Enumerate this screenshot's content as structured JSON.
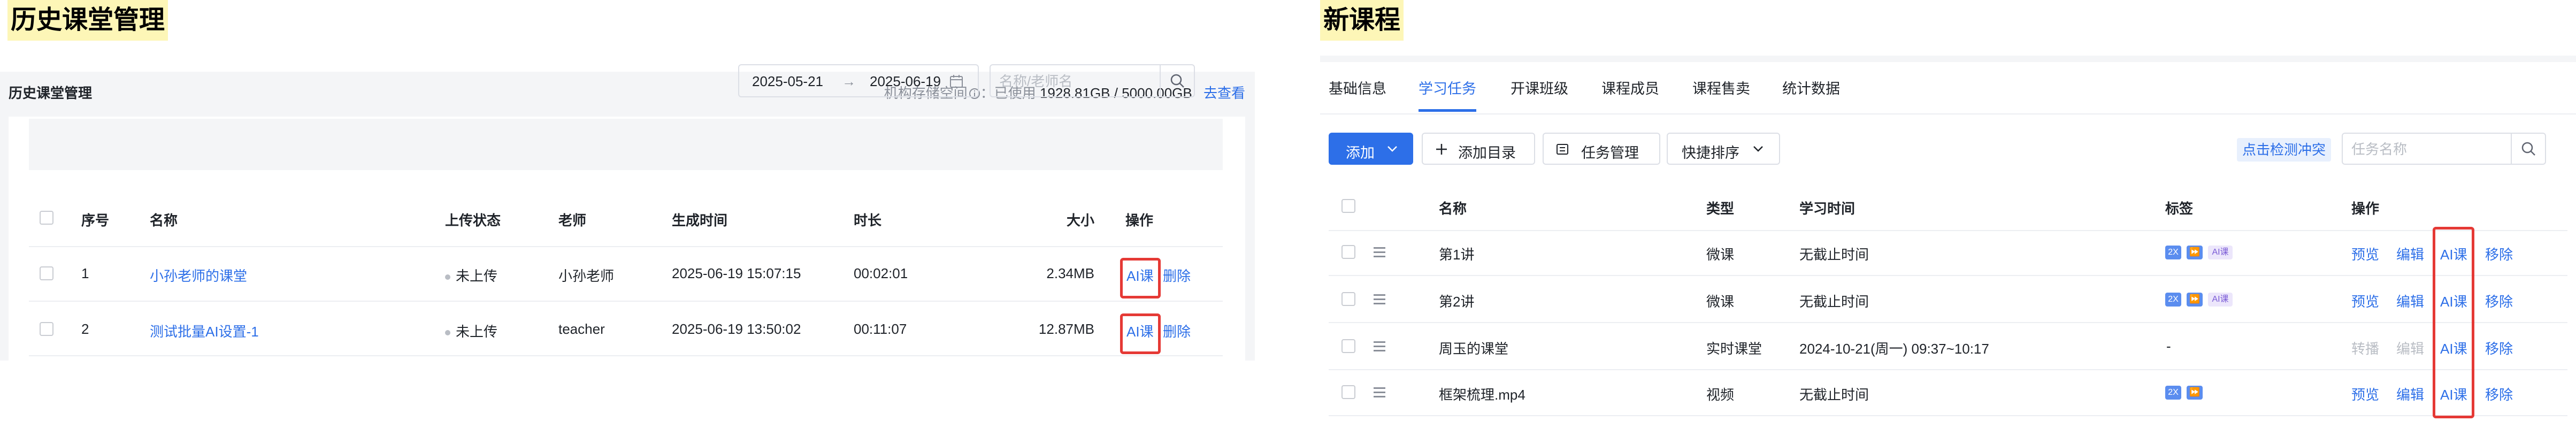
{
  "left": {
    "section_title": "历史课堂管理",
    "panel_title": "历史课堂管理",
    "storage": {
      "label": "机构存储空间",
      "info_icon": "info-circle-icon",
      "used_label": "：已使用",
      "value": "1928.81GB / 5000.00GB",
      "link": "去查看"
    },
    "date_range": {
      "start": "2025-05-21",
      "separator": "→",
      "end": "2025-06-19",
      "icon": "calendar-icon"
    },
    "search": {
      "placeholder": "名称/老师名",
      "icon": "search-icon"
    },
    "columns": {
      "index": "序号",
      "name": "名称",
      "upload_status": "上传状态",
      "teacher": "老师",
      "created": "生成时间",
      "duration": "时长",
      "size": "大小",
      "actions": "操作"
    },
    "rows": [
      {
        "index": "1",
        "name": "小孙老师的课堂",
        "upload_status": "未上传",
        "teacher": "小孙老师",
        "created": "2025-06-19 15:07:15",
        "duration": "00:02:01",
        "size": "2.34MB",
        "action_ai": "AI课",
        "action_delete": "删除"
      },
      {
        "index": "2",
        "name": "测试批量AI设置-1",
        "upload_status": "未上传",
        "teacher": "teacher",
        "created": "2025-06-19 13:50:02",
        "duration": "00:11:07",
        "size": "12.87MB",
        "action_ai": "AI课",
        "action_delete": "删除"
      }
    ]
  },
  "right": {
    "section_title": "新课程",
    "tabs": [
      "基础信息",
      "学习任务",
      "开课班级",
      "课程成员",
      "课程售卖",
      "统计数据"
    ],
    "active_tab": "学习任务",
    "toolbar": {
      "add": "添加",
      "add_dir": "添加目录",
      "task_manage": "任务管理",
      "quick_sort": "快捷排序",
      "check_conflict": "点击检测冲突",
      "search_placeholder": "任务名称"
    },
    "columns": {
      "name": "名称",
      "type": "类型",
      "time": "学习时间",
      "tags": "标签",
      "actions": "操作"
    },
    "tag_labels": {
      "t1": "2X",
      "t3": "AI课"
    },
    "rows": [
      {
        "name": "第1讲",
        "type": "微课",
        "time": "无截止时间",
        "tags": "2x-ff-ai",
        "a1": "预览",
        "a2": "编辑",
        "a3": "AI课",
        "a4": "移除"
      },
      {
        "name": "第2讲",
        "type": "微课",
        "time": "无截止时间",
        "tags": "2x-ff-ai",
        "a1": "预览",
        "a2": "编辑",
        "a3": "AI课",
        "a4": "移除"
      },
      {
        "name": "周玉的课堂",
        "type": "实时课堂",
        "time": "2024-10-21(周一) 09:37~10:17",
        "tags": "-",
        "a1": "转播",
        "a2": "编辑",
        "a3": "AI课",
        "a4": "移除"
      },
      {
        "name": "框架梳理.mp4",
        "type": "视频",
        "time": "无截止时间",
        "tags": "2x-ff",
        "a1": "预览",
        "a2": "编辑",
        "a3": "AI课",
        "a4": "移除"
      }
    ]
  },
  "colors": {
    "accent": "#2d6fe8",
    "highlight": "#fdf6b7",
    "annotation_box": "#e53935"
  }
}
